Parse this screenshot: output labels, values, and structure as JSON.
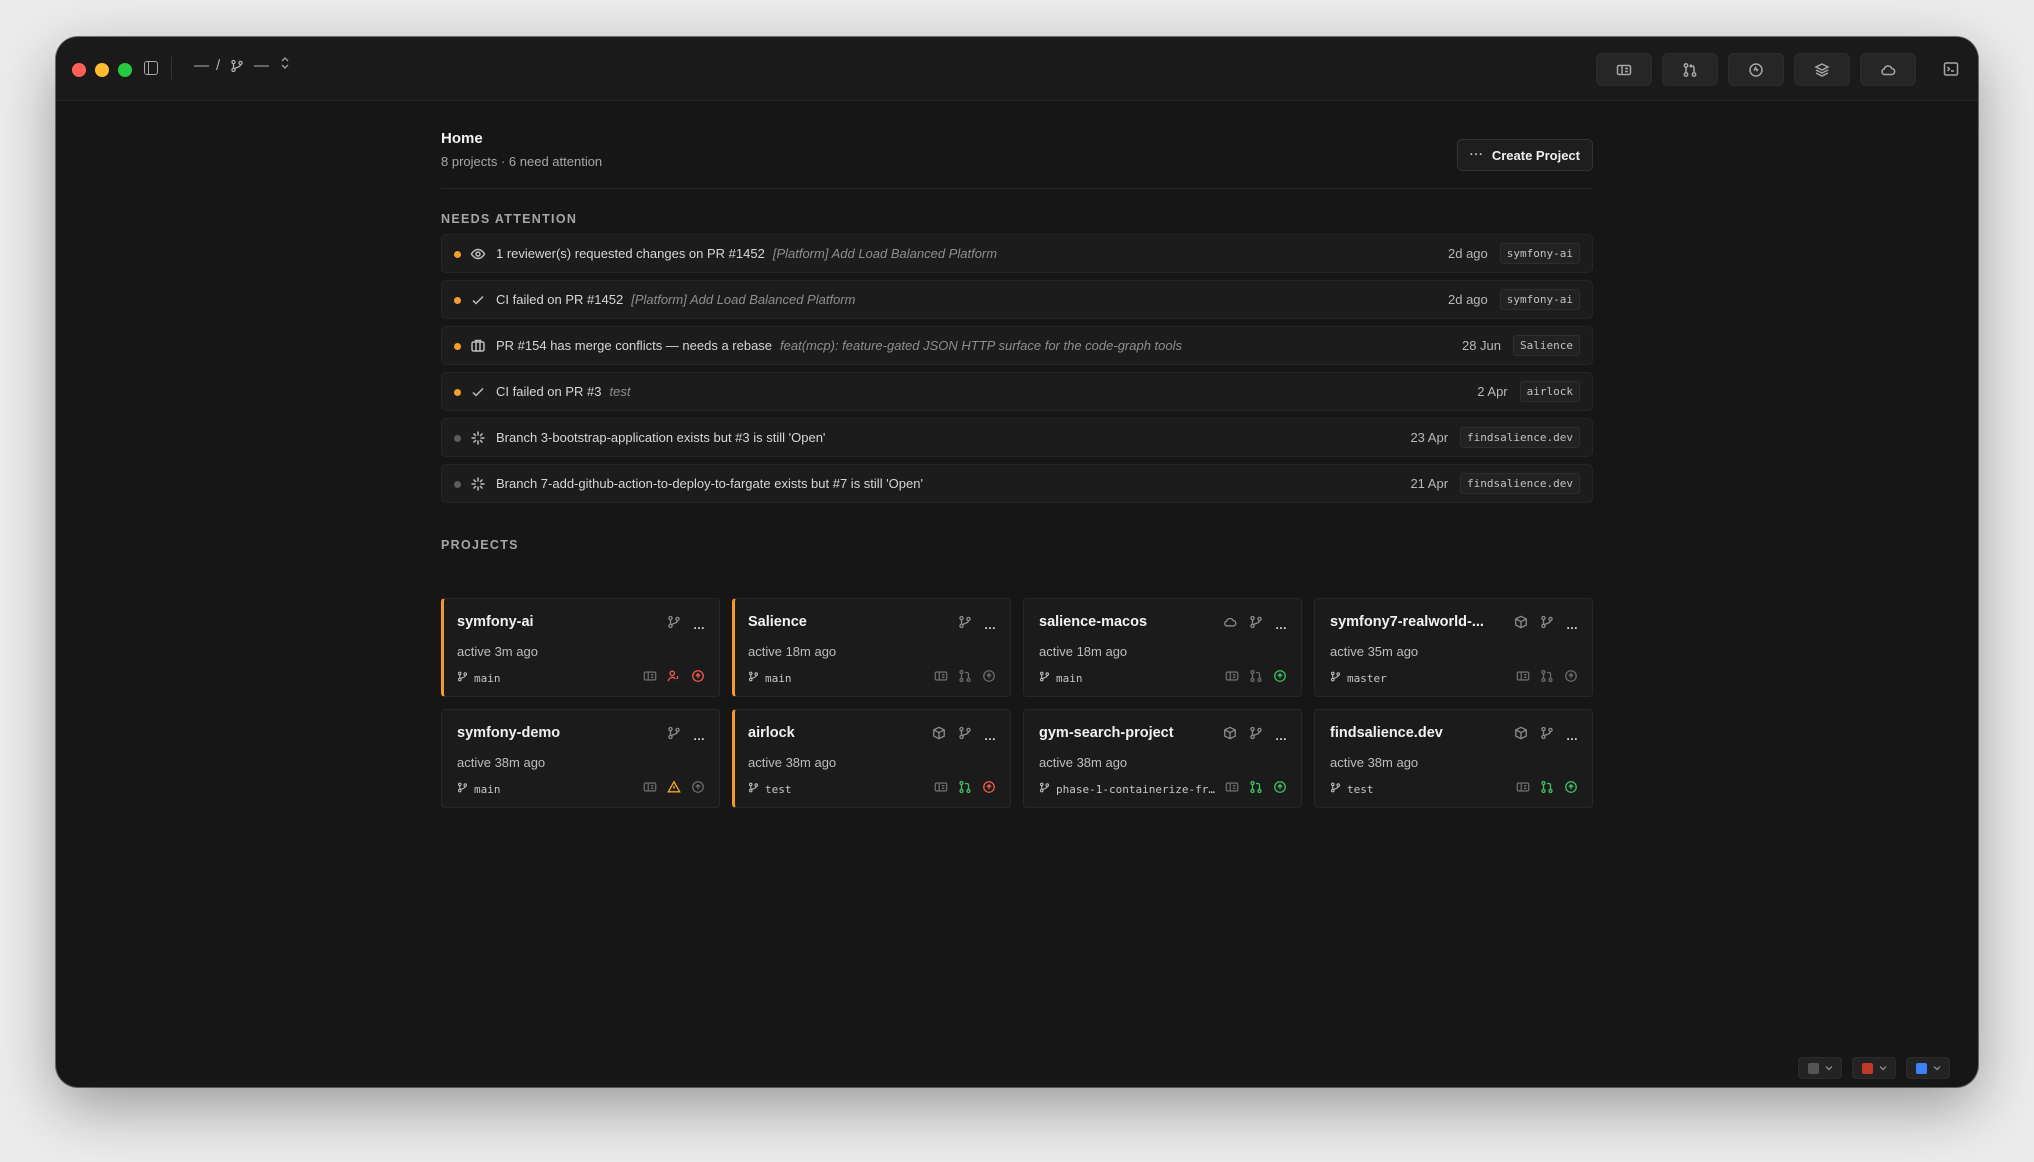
{
  "titlebar": {
    "crumb_project": "—",
    "crumb_sep": "/",
    "crumb_branch": "—",
    "crumb_toggle": "⌃⌄"
  },
  "home": {
    "title": "Home",
    "subtitle": "8 projects · 6 need attention",
    "create_label": "Create Project",
    "create_dots": "···"
  },
  "needs_attention": {
    "label": "NEEDS ATTENTION",
    "items": [
      {
        "dot": "orange",
        "icon": "eye-icon",
        "text": "1 reviewer(s) requested changes on PR #1452",
        "pr_title": "[Platform] Add Load Balanced Platform",
        "time": "2d ago",
        "project": "symfony-ai"
      },
      {
        "dot": "orange",
        "icon": "check-icon",
        "text": "CI failed on PR #1452",
        "pr_title": "[Platform] Add Load Balanced Platform",
        "time": "2d ago",
        "project": "symfony-ai"
      },
      {
        "dot": "orange",
        "icon": "merge-conflict-icon",
        "text": "PR #154 has merge conflicts — needs a rebase",
        "pr_title": "feat(mcp): feature-gated JSON HTTP surface for the code-graph tools",
        "time": "28 Jun",
        "project": "Salience"
      },
      {
        "dot": "orange",
        "icon": "check-icon",
        "text": "CI failed on PR #3",
        "pr_title": "test",
        "time": "2 Apr",
        "project": "airlock"
      },
      {
        "dot": "gray",
        "icon": "sparkle-icon",
        "text": "Branch 3-bootstrap-application exists but #3 is still 'Open'",
        "pr_title": "",
        "time": "23 Apr",
        "project": "findsalience.dev"
      },
      {
        "dot": "gray",
        "icon": "sparkle-icon",
        "text": "Branch 7-add-github-action-to-deploy-to-fargate exists but #7 is still 'Open'",
        "pr_title": "",
        "time": "21 Apr",
        "project": "findsalience.dev"
      }
    ]
  },
  "projects": {
    "label": "PROJECTS",
    "items": [
      {
        "name": "symfony-ai",
        "active": "active 3m ago",
        "branch": "main",
        "accent": true,
        "extra_icon": "",
        "status": [
          "gray",
          "red",
          "red"
        ],
        "mid_icon": "person-alert-icon"
      },
      {
        "name": "Salience",
        "active": "active 18m ago",
        "branch": "main",
        "accent": true,
        "extra_icon": "",
        "status": [
          "gray",
          "gray",
          "gray"
        ],
        "mid_icon": "pr-icon"
      },
      {
        "name": "salience-macos",
        "active": "active 18m ago",
        "branch": "main",
        "accent": false,
        "extra_icon": "cloud-icon",
        "status": [
          "gray",
          "gray",
          "green"
        ],
        "mid_icon": "pr-icon"
      },
      {
        "name": "symfony7-realworld-...",
        "active": "active 35m ago",
        "branch": "master",
        "accent": false,
        "extra_icon": "cube-icon",
        "status": [
          "gray",
          "gray",
          "gray"
        ],
        "mid_icon": "pr-icon"
      },
      {
        "name": "symfony-demo",
        "active": "active 38m ago",
        "branch": "main",
        "accent": false,
        "extra_icon": "",
        "status": [
          "gray",
          "warn",
          "gray"
        ],
        "mid_icon": "warning-icon"
      },
      {
        "name": "airlock",
        "active": "active 38m ago",
        "branch": "test",
        "accent": true,
        "extra_icon": "cube-icon",
        "status": [
          "gray",
          "green",
          "red"
        ],
        "mid_icon": "pr-icon"
      },
      {
        "name": "gym-search-project",
        "active": "active 38m ago",
        "branch": "phase-1-containerize-fr…",
        "accent": false,
        "extra_icon": "cube-icon",
        "status": [
          "gray",
          "green",
          "green"
        ],
        "mid_icon": "pr-icon"
      },
      {
        "name": "findsalience.dev",
        "active": "active 38m ago",
        "branch": "test",
        "accent": false,
        "extra_icon": "cube-icon",
        "status": [
          "gray",
          "green",
          "green"
        ],
        "mid_icon": "pr-icon"
      }
    ]
  },
  "colors": {
    "accent": "#f39a2b",
    "success": "#3fbf63",
    "danger": "#ef5a4f",
    "warning": "#f5a623"
  }
}
